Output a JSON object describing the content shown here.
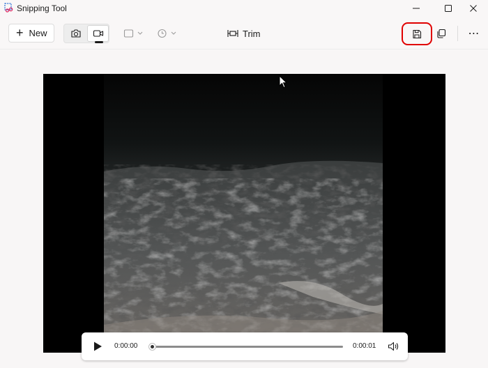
{
  "window": {
    "title": "Snipping Tool",
    "controls": [
      "minimize",
      "maximize",
      "close"
    ]
  },
  "toolbar": {
    "new_label": "New",
    "modes": [
      {
        "name": "screenshot-mode",
        "icon": "camera-icon",
        "selected": false
      },
      {
        "name": "video-mode",
        "icon": "video-camera-icon",
        "selected": true
      }
    ],
    "shape_dropdown_icon": "rectangle-snip-icon",
    "timer_dropdown_icon": "clock-icon",
    "trim_label": "Trim",
    "save_icon": "save-icon",
    "copy_icon": "copy-icon",
    "more_label": "⋯"
  },
  "player": {
    "current_time": "0:00:00",
    "total_time": "0:00:01",
    "progress": 0
  },
  "highlight": {
    "target": "save-button",
    "color": "#e00000"
  }
}
